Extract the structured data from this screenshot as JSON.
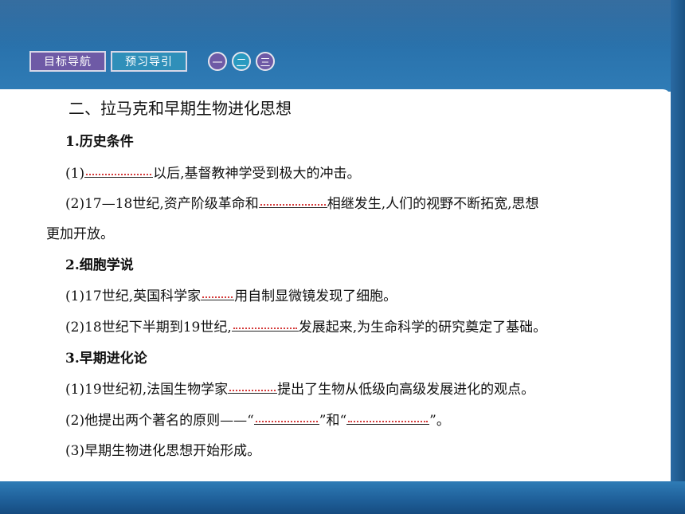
{
  "nav": {
    "buttons": [
      "目标导航",
      "预习导引"
    ],
    "circles": [
      "一",
      "二",
      "三"
    ]
  },
  "content": {
    "title": "二、拉马克和早期生物进化思想",
    "h1": "1.历史条件",
    "p1_pre": "(1)",
    "p1_post": "以后,基督教神学受到极大的冲击。",
    "p2_pre": "(2)17—18世纪,资产阶级革命和",
    "p2_post": "相继发生,人们的视野不断拓宽,思想",
    "p2_cont": "更加开放。",
    "h2": "2.细胞学说",
    "p3_pre": "(1)17世纪,英国科学家",
    "p3_post": "用自制显微镜发现了细胞。",
    "p4_pre": "(2)18世纪下半期到19世纪,",
    "p4_post": "发展起来,为生命科学的研究奠定了基础。",
    "h3": "3.早期进化论",
    "p5_pre": "(1)19世纪初,法国生物学家",
    "p5_post": "提出了生物从低级向高级发展进化的观点。",
    "p6_pre": "(2)他提出两个著名的原则——“",
    "p6_mid": "”和“",
    "p6_post": "”。",
    "p7": "(3)早期生物进化思想开始形成。"
  },
  "colors": {
    "banner": "#2a73ad",
    "nav_purple": "#6e5aa6",
    "nav_blue": "#2f8fb9",
    "blank_mark": "#d43a3a"
  }
}
